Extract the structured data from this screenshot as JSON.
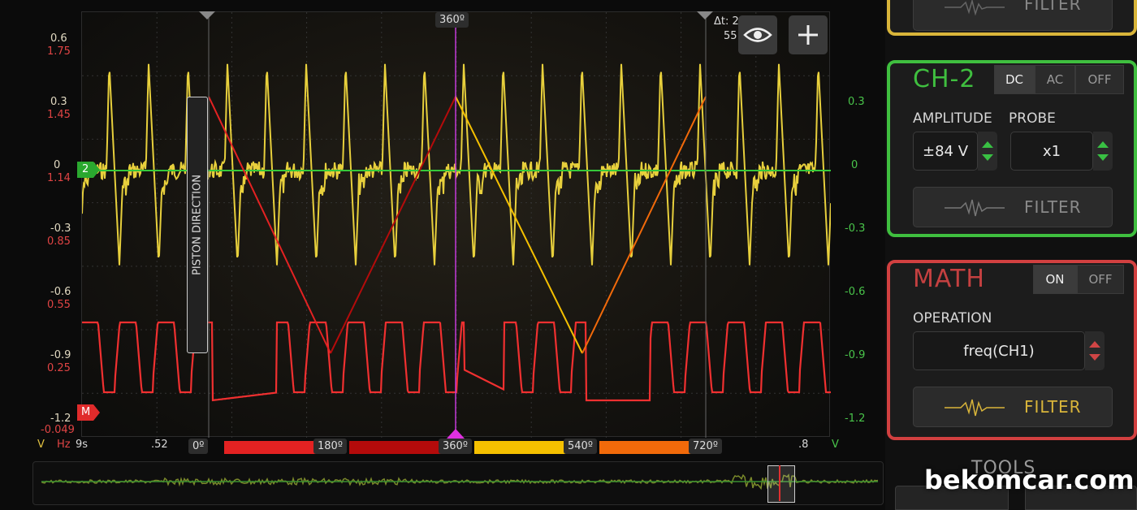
{
  "scope": {
    "left_axis": {
      "ch1_values": [
        "0.6",
        "0.3",
        "0",
        "-0.3",
        "-0.6",
        "-0.9",
        "-1.2"
      ],
      "ch_red_values": [
        "1.75",
        "1.45",
        "1.14",
        "0.85",
        "0.55",
        "0.25",
        "-0.049"
      ],
      "unit_v": "V",
      "unit_hz": "Hz"
    },
    "right_axis": {
      "values": [
        "0.3",
        "0",
        "-0.3",
        "-0.6",
        "-0.9",
        "-1.2"
      ],
      "unit": "V"
    },
    "time_axis": {
      "labels": [
        "9s",
        ".52",
        ".8"
      ]
    },
    "delta_t_label": "Δt: 2",
    "delta_t_label2": "55",
    "top_marker": "360º",
    "channel_marker_2": "2",
    "channel_marker_m": "M",
    "piston_direction": "PISTON DIRECTION",
    "degree_markers": [
      "0º",
      "180º",
      "360º",
      "540º",
      "720º"
    ],
    "segment_colors": [
      "#e42222",
      "#b40b0b",
      "#f5c000",
      "#f26a0a"
    ],
    "icons": {
      "eye": "eye-icon",
      "plus": "plus-icon"
    },
    "trace_colors": {
      "ch1": "#e7cf3c",
      "math": "#f03030",
      "ch2": "#35c83a"
    }
  },
  "ch1_panel": {
    "filter_label": "FILTER",
    "accent": "#d9b53a"
  },
  "ch2_panel": {
    "title": "CH-2",
    "accent": "#3fbf3f",
    "coupling": [
      "DC",
      "AC",
      "OFF"
    ],
    "coupling_selected": "DC",
    "amplitude_label": "AMPLITUDE",
    "amplitude_value": "±84 V",
    "probe_label": "PROBE",
    "probe_value": "x1",
    "filter_label": "FILTER"
  },
  "math_panel": {
    "title": "MATH",
    "accent": "#d24040",
    "state": [
      "ON",
      "OFF"
    ],
    "state_selected": "ON",
    "operation_label": "OPERATION",
    "operation_value": "freq(CH1)",
    "filter_label": "FILTER"
  },
  "tools_label": "TOOLS",
  "watermark": "bekomcar.com"
}
